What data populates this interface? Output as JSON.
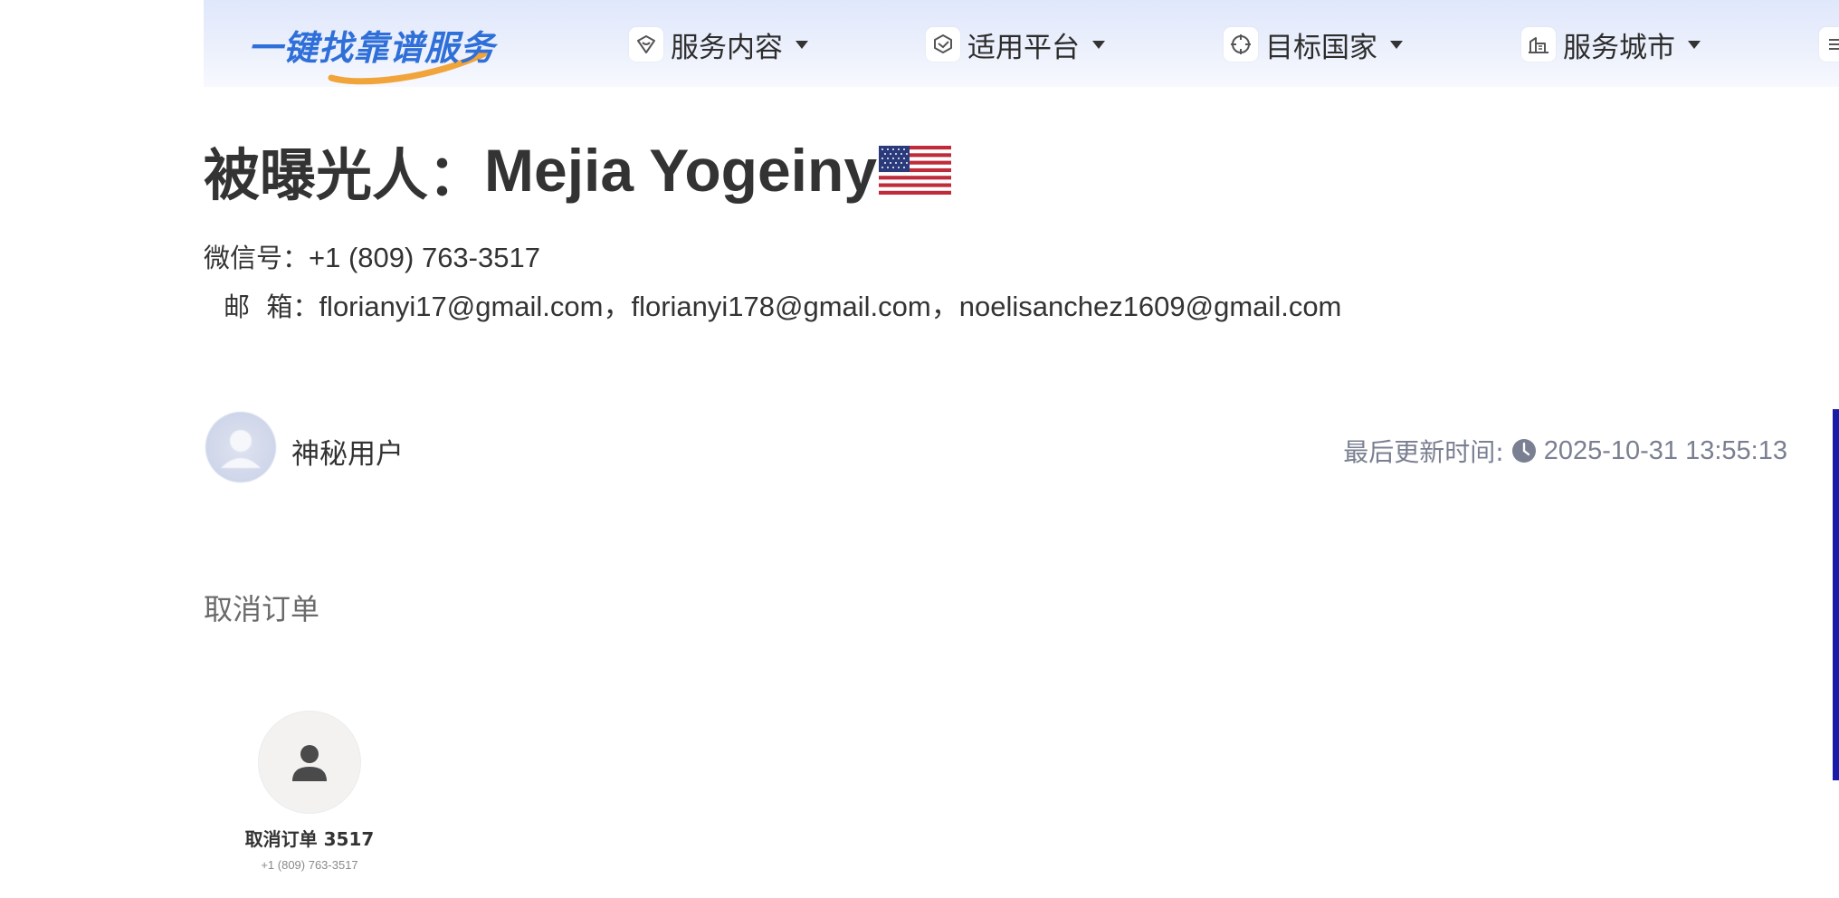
{
  "header": {
    "logo_text": "一键找靠谱服务",
    "nav": [
      {
        "label": "服务内容",
        "icon": "shield-heart-icon"
      },
      {
        "label": "适用平台",
        "icon": "cube-icon"
      },
      {
        "label": "目标国家",
        "icon": "crosshair-icon"
      },
      {
        "label": "服务城市",
        "icon": "building-icon"
      }
    ]
  },
  "profile": {
    "title_prefix": "被曝光人：",
    "name": "Mejia Yogeiny",
    "flag": "us-flag-icon",
    "wechat_label": "微信号：",
    "wechat": "+1 (809) 763-3517",
    "email_label": "邮  箱：",
    "emails": "florianyi17@gmail.com，florianyi178@gmail.com，noelisanchez1609@gmail.com"
  },
  "author": {
    "name": "神秘用户",
    "updated_label": "最后更新时间:",
    "updated_at": "2025-10-31 13:55:13"
  },
  "section": {
    "title": "取消订单"
  },
  "contact": {
    "name": "取消订单 3517",
    "phone": "+1 (809) 763-3517"
  },
  "colors": {
    "logo_blue": "#2f6fd9",
    "logo_orange": "#f0a43a",
    "accent_bar": "#1a1aa8",
    "muted": "#7a7f92"
  }
}
